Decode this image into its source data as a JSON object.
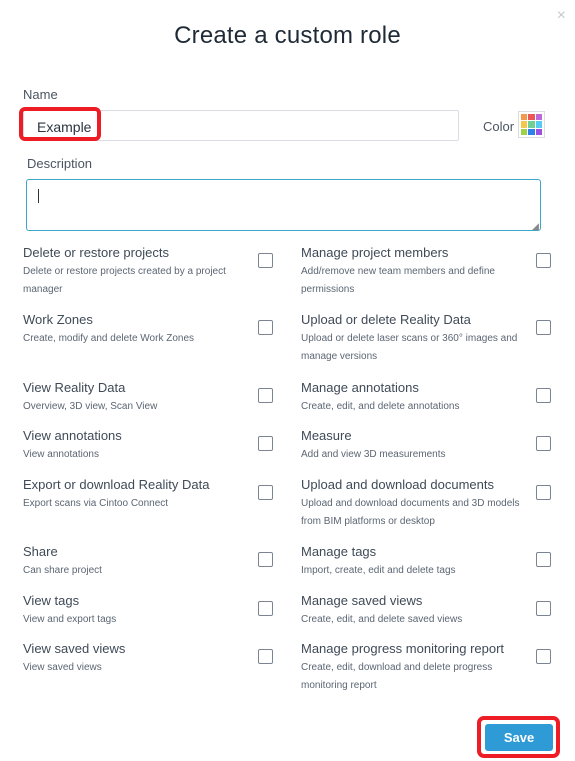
{
  "dialog": {
    "title": "Create a custom role",
    "close_glyph": "×"
  },
  "name": {
    "label": "Name",
    "value": "Example"
  },
  "color": {
    "label": "Color",
    "swatches": [
      "#f2994a",
      "#eb5757",
      "#bb6bd9",
      "#f2c94c",
      "#6fcf97",
      "#56ccf2",
      "#9bd24b",
      "#2f80ed",
      "#9b51e0"
    ]
  },
  "description": {
    "label": "Description",
    "value": ""
  },
  "permissions": [
    {
      "title": "Delete or restore projects",
      "desc": "Delete or restore projects created by a project manager",
      "checked": false
    },
    {
      "title": "Manage project members",
      "desc": "Add/remove new team members and define permissions",
      "checked": false
    },
    {
      "title": "Work Zones",
      "desc": "Create, modify and delete Work Zones",
      "checked": false
    },
    {
      "title": "Upload or delete Reality Data",
      "desc": "Upload or delete laser scans or 360° images and manage versions",
      "checked": false
    },
    {
      "title": "View Reality Data",
      "desc": "Overview, 3D view, Scan View",
      "checked": false
    },
    {
      "title": "Manage annotations",
      "desc": "Create, edit, and delete annotations",
      "checked": false
    },
    {
      "title": "View annotations",
      "desc": "View annotations",
      "checked": false
    },
    {
      "title": "Measure",
      "desc": "Add and view 3D measurements",
      "checked": false
    },
    {
      "title": "Export or download Reality Data",
      "desc": "Export scans via Cintoo Connect",
      "checked": false
    },
    {
      "title": "Upload and download documents",
      "desc": "Upload and download documents and 3D models from BIM platforms or desktop",
      "checked": false
    },
    {
      "title": "Share",
      "desc": "Can share project",
      "checked": false
    },
    {
      "title": "Manage tags",
      "desc": "Import, create, edit and delete tags",
      "checked": false
    },
    {
      "title": "View tags",
      "desc": "View and export tags",
      "checked": false
    },
    {
      "title": "Manage saved views",
      "desc": "Create, edit, and delete saved views",
      "checked": false
    },
    {
      "title": "View saved views",
      "desc": "View saved views",
      "checked": false
    },
    {
      "title": "Manage progress monitoring report",
      "desc": "Create, edit, download and delete progress monitoring report",
      "checked": false
    }
  ],
  "actions": {
    "save_label": "Save"
  }
}
